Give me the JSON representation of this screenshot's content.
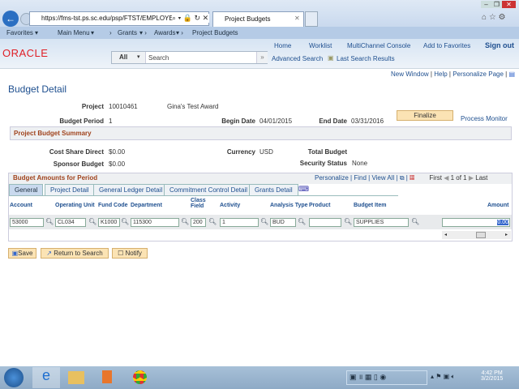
{
  "browser": {
    "url": "https://fms-tst.ps.sc.edu/psp/FTST/EMPLOYEE/ERP/c/MANA",
    "tab_title": "Project Budgets"
  },
  "nav": {
    "favorites": "Favorites",
    "main_menu": "Main Menu",
    "crumbs": [
      "Grants",
      "Awards",
      "Project Budgets"
    ]
  },
  "header": {
    "logo": "ORACLE",
    "links": [
      "Home",
      "Worklist",
      "MultiChannel Console",
      "Add to Favorites",
      "Sign out"
    ],
    "search_scope": "All",
    "search_placeholder": "Search",
    "advanced_search": "Advanced Search",
    "last_search": "Last Search Results"
  },
  "pagebar": {
    "new_window": "New Window",
    "help": "Help",
    "personalize": "Personalize Page"
  },
  "page": {
    "title": "Budget Detail",
    "project_label": "Project",
    "project": "10010461",
    "project_desc": "Gina's Test Award",
    "period_label": "Budget Period",
    "period": "1",
    "begin_label": "Begin Date",
    "begin": "04/01/2015",
    "end_label": "End Date",
    "end": "03/31/2016",
    "finalize": "Finalize",
    "process_monitor": "Process Monitor",
    "summary_title": "Project Budget Summary",
    "cost_share_label": "Cost Share Direct",
    "cost_share": "$0.00",
    "currency_label": "Currency",
    "currency": "USD",
    "total_label": "Total Budget",
    "sponsor_label": "Sponsor Budget",
    "sponsor": "$0.00",
    "security_label": "Security Status",
    "security": "None"
  },
  "grid": {
    "title": "Budget Amounts for Period",
    "personalize": "Personalize",
    "find": "Find",
    "view_all": "View All",
    "first": "First",
    "count": "1 of 1",
    "last": "Last",
    "tabs": [
      "General",
      "Project Detail",
      "General Ledger Detail",
      "Commitment Control Detail",
      "Grants Detail"
    ],
    "columns": [
      "Account",
      "Operating Unit",
      "Fund Code",
      "Department",
      "Class Field",
      "Activity",
      "Analysis Type",
      "Product",
      "Budget Item",
      "Amount"
    ],
    "row": [
      "53000",
      "CL034",
      "K1000",
      "115300",
      "200",
      "1",
      "BUD",
      "",
      "SUPPLIES",
      "0.00"
    ]
  },
  "buttons": {
    "save": "Save",
    "return": "Return to Search",
    "notify": "Notify"
  },
  "taskbar": {
    "time": "4:42 PM",
    "date": "3/2/2015"
  }
}
